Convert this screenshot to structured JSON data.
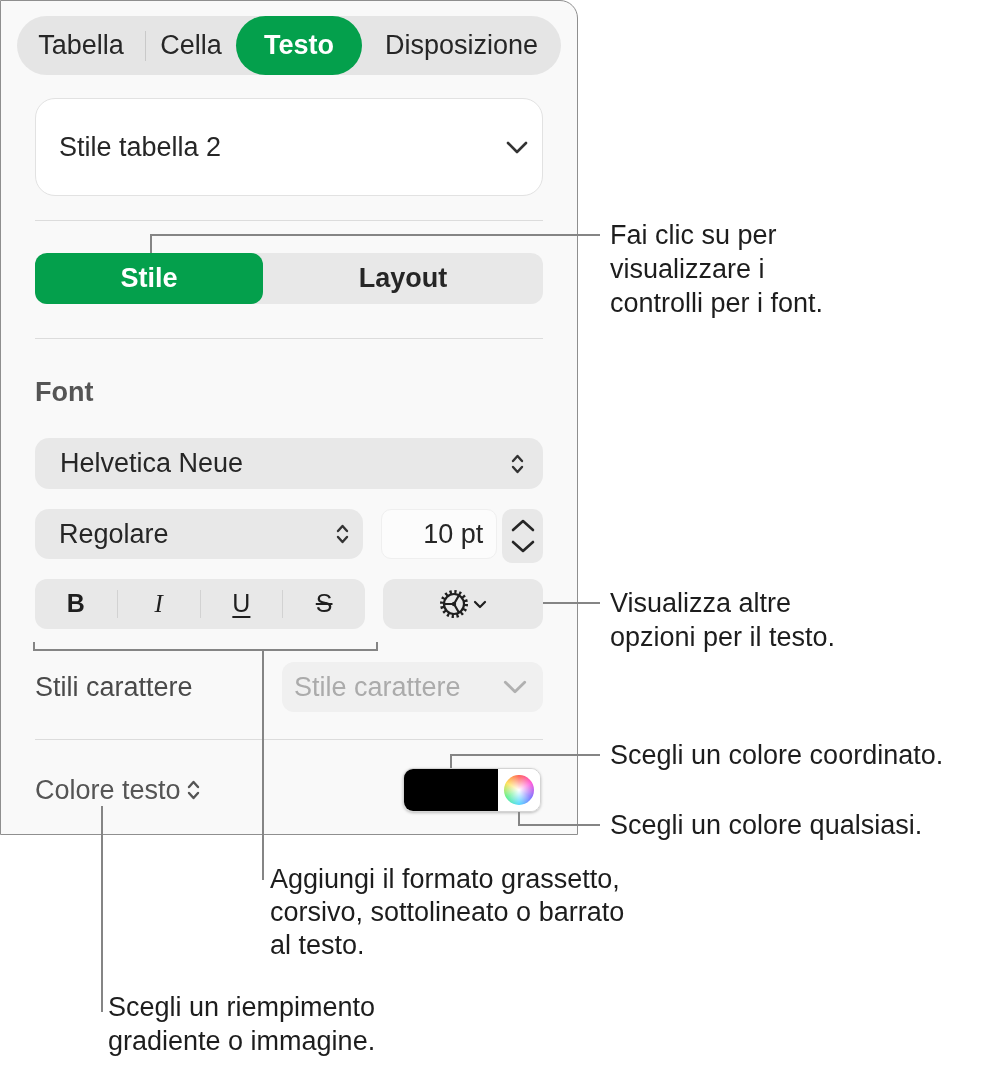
{
  "tabs": [
    {
      "label": "Tabella",
      "selected": false
    },
    {
      "label": "Cella",
      "selected": false
    },
    {
      "label": "Testo",
      "selected": true
    },
    {
      "label": "Disposizione",
      "selected": false
    }
  ],
  "table_style": "Stile tabella 2",
  "text_modes": [
    {
      "label": "Stile",
      "selected": true
    },
    {
      "label": "Layout",
      "selected": false
    }
  ],
  "font": {
    "heading": "Font",
    "family": "Helvetica Neue",
    "typeface": "Regolare",
    "size": "10 pt",
    "format_buttons": [
      {
        "label": "B",
        "kind": "bold"
      },
      {
        "label": "I",
        "kind": "italic"
      },
      {
        "label": "U",
        "kind": "underline"
      },
      {
        "label": "S",
        "kind": "strikethrough"
      }
    ]
  },
  "character_styles": {
    "label": "Stili carattere",
    "value": "Stile carattere",
    "disabled": true
  },
  "text_color": {
    "label": "Colore testo",
    "color": "#000000"
  },
  "callouts": [
    "Fai clic su per\nvisualizzare i\ncontrolli per i font.",
    "Visualizza altre\nopzioni per il testo.",
    "Scegli un colore coordinato.",
    "Scegli un colore qualsiasi.",
    "Aggiungi il formato grassetto,\ncorsivo, sottolineato o barrato\nal testo.",
    "Scegli un riempimento\ngradiente o immagine."
  ]
}
